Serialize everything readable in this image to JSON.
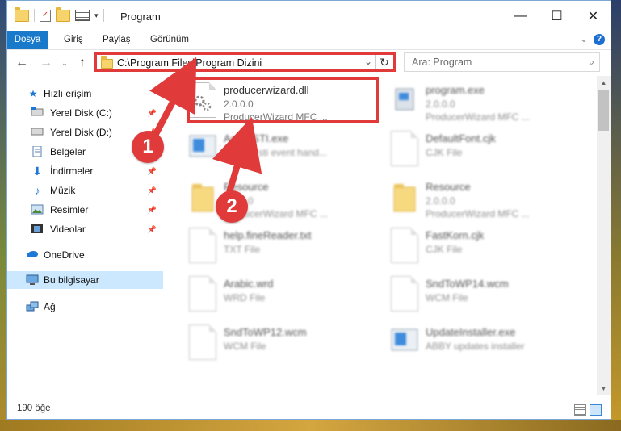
{
  "window": {
    "title": "Program",
    "controls": {
      "minimize": "—",
      "maximize": "☐",
      "close": "✕"
    }
  },
  "ribbon": {
    "tabs": [
      "Dosya",
      "Giriş",
      "Paylaş",
      "Görünüm"
    ],
    "help": "?"
  },
  "address": {
    "path": "C:\\Program Files\\Program Dizini"
  },
  "search": {
    "placeholder": "Ara: Program"
  },
  "nav": {
    "items": [
      {
        "label": "Hızlı erişim",
        "icon": "star-icon"
      },
      {
        "label": "Yerel Disk (C:)",
        "icon": "drive-icon",
        "pinned": true
      },
      {
        "label": "Yerel Disk (D:)",
        "icon": "drive-icon",
        "pinned": true
      },
      {
        "label": "Belgeler",
        "icon": "documents-icon",
        "pinned": true
      },
      {
        "label": "İndirmeler",
        "icon": "download-icon",
        "pinned": true
      },
      {
        "label": "Müzik",
        "icon": "music-icon",
        "pinned": true
      },
      {
        "label": "Resimler",
        "icon": "pictures-icon",
        "pinned": true
      },
      {
        "label": "Videolar",
        "icon": "videos-icon",
        "pinned": true
      },
      {
        "label": "OneDrive",
        "icon": "cloud-icon"
      },
      {
        "label": "Bu bilgisayar",
        "icon": "computer-icon",
        "selected": true
      },
      {
        "label": "Ağ",
        "icon": "network-icon"
      }
    ]
  },
  "files": [
    {
      "name": "producerwizard.dll",
      "l1": "2.0.0.0",
      "l2": "ProducerWizard MFC ...",
      "icon": "dll"
    },
    {
      "name": "program.exe",
      "l1": "2.0.0.0",
      "l2": "ProducerWizard MFC ...",
      "icon": "exe"
    },
    {
      "name": "ActiveSTI.exe",
      "l1": "ABBYY sti event hand...",
      "l2": "",
      "icon": "app"
    },
    {
      "name": "DefaultFont.cjk",
      "l1": "CJK File",
      "l2": "",
      "icon": "doc"
    },
    {
      "name": "Resource",
      "l1": "2.0.0.0",
      "l2": "ProducerWizard MFC ...",
      "icon": "folder"
    },
    {
      "name": "Resource",
      "l1": "2.0.0.0",
      "l2": "ProducerWizard MFC ...",
      "icon": "folder"
    },
    {
      "name": "help.fineReader.txt",
      "l1": "TXT File",
      "l2": "",
      "icon": "doc"
    },
    {
      "name": "FastKorn.cjk",
      "l1": "CJK File",
      "l2": "",
      "icon": "doc"
    },
    {
      "name": "Arabic.wrd",
      "l1": "WRD File",
      "l2": "",
      "icon": "doc"
    },
    {
      "name": "SndToWP14.wcm",
      "l1": "WCM File",
      "l2": "",
      "icon": "doc"
    },
    {
      "name": "SndToWP12.wcm",
      "l1": "WCM File",
      "l2": "",
      "icon": "doc"
    },
    {
      "name": "UpdateInstaller.exe",
      "l1": "ABBY updates installer",
      "l2": "",
      "icon": "app"
    }
  ],
  "status": {
    "count": "190 öğe"
  },
  "annotations": {
    "badge1": "1",
    "badge2": "2",
    "color": "#e03a3a"
  }
}
